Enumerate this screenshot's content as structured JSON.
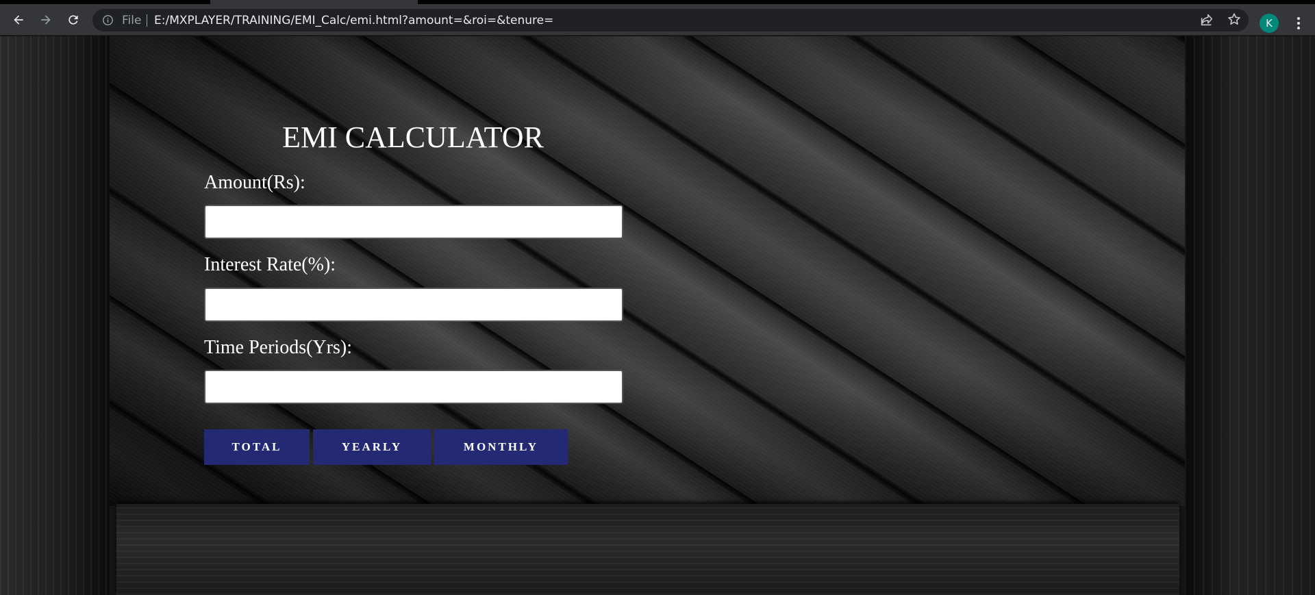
{
  "browser": {
    "site_label": "File",
    "url": "E:/MXPLAYER/TRAINING/EMI_Calc/emi.html?amount=&roi=&tenure=",
    "profile_initial": "K",
    "icons": [
      "back-icon",
      "forward-icon",
      "reload-icon",
      "info-icon",
      "share-icon",
      "star-icon",
      "menu-icon"
    ]
  },
  "emi": {
    "title": "EMI CALCULATOR",
    "fields": [
      {
        "label": "Amount(Rs):",
        "value": ""
      },
      {
        "label": "Interest Rate(%):",
        "value": ""
      },
      {
        "label": "Time Periods(Yrs):",
        "value": ""
      }
    ],
    "buttons": {
      "total": "TOTAL",
      "yearly": "YEARLY",
      "monthly": "MONTHLY"
    }
  },
  "colors": {
    "button_bg": "#232a73",
    "avatar_bg": "#00897b"
  }
}
